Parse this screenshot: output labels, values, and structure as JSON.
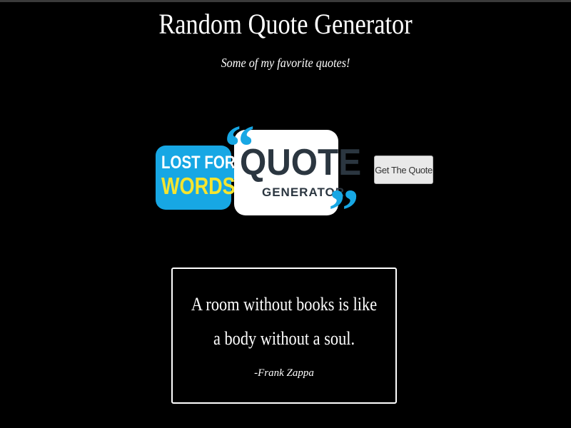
{
  "header": {
    "title": "Random Quote Generator",
    "subtitle": "Some of my favorite quotes!"
  },
  "logo": {
    "line1": "LOST FOR",
    "line2": "WORDS?",
    "word_quote": "QUOTE",
    "word_generator": "GENERATOR",
    "open_quote_mark": "“",
    "close_quote_mark": "”"
  },
  "controls": {
    "get_quote_label": "Get The Quote"
  },
  "quote": {
    "text": "A room without books is like a body without a soul.",
    "author": "-Frank Zappa"
  },
  "colors": {
    "background": "#000000",
    "text": "#ffffff",
    "logo_blue": "#17a7e4",
    "logo_yellow": "#f5e52f",
    "logo_dark": "#2b3640"
  }
}
